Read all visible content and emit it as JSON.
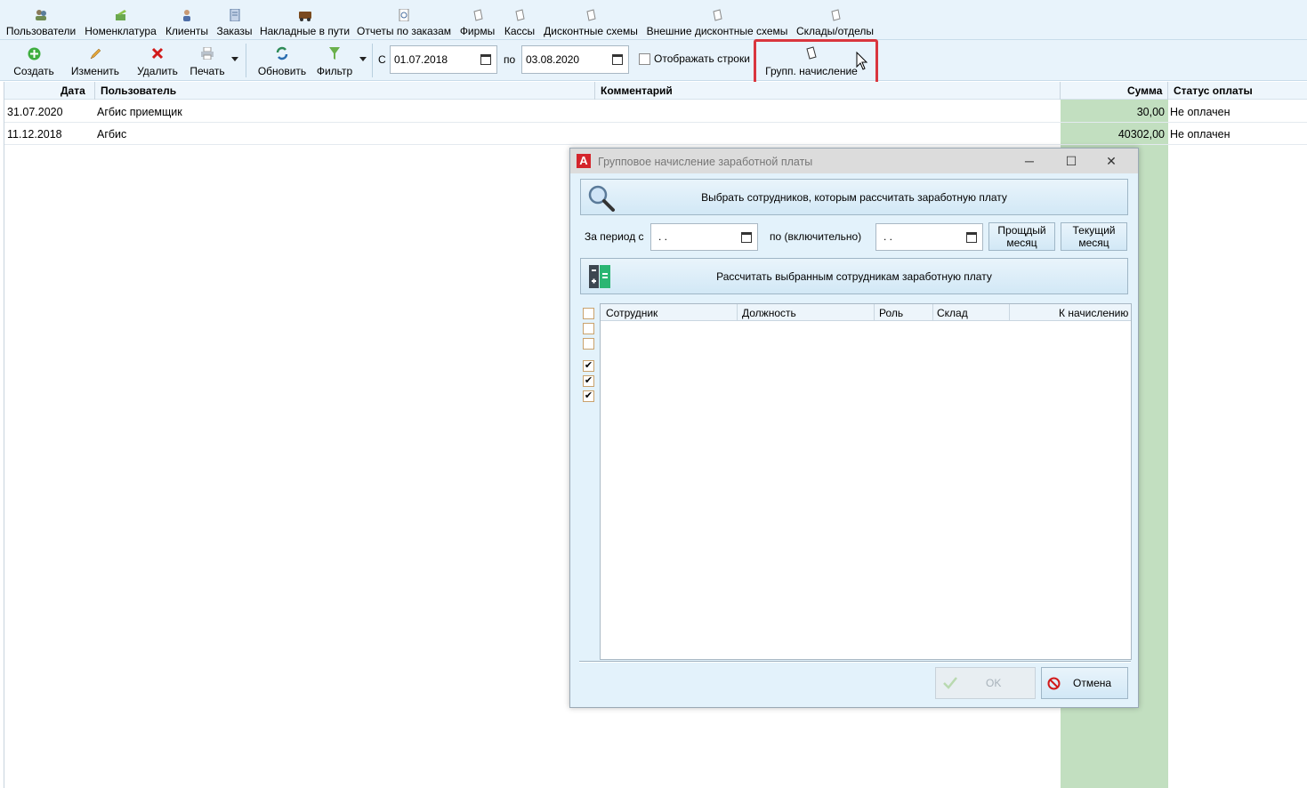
{
  "menu": {
    "items": [
      {
        "label": "Пользователи",
        "icon": "users-icon"
      },
      {
        "label": "Номенклатура",
        "icon": "nomenclature-icon"
      },
      {
        "label": "Клиенты",
        "icon": "clients-icon"
      },
      {
        "label": "Заказы",
        "icon": "orders-icon"
      },
      {
        "label": "Накладные в пути",
        "icon": "truck-icon"
      },
      {
        "label": "Отчеты по заказам",
        "icon": "report-icon"
      },
      {
        "label": "Фирмы",
        "icon": "document-icon"
      },
      {
        "label": "Кассы",
        "icon": "document-icon"
      },
      {
        "label": "Дисконтные схемы",
        "icon": "document-icon"
      },
      {
        "label": "Внешние дисконтные схемы",
        "icon": "document-icon"
      },
      {
        "label": "Склады/отделы",
        "icon": "document-icon"
      }
    ]
  },
  "toolbar": {
    "create": "Создать",
    "edit": "Изменить",
    "delete": "Удалить",
    "print": "Печать",
    "refresh": "Обновить",
    "filter": "Фильтр",
    "from_label": "С",
    "from_date": "01.07.2018",
    "to_label": "по",
    "to_date": "03.08.2020",
    "show_rows": "Отображать строки",
    "group_accrual": "Групп. начисление"
  },
  "grid": {
    "columns": [
      "Дата",
      "Пользователь",
      "Комментарий",
      "Сумма",
      "Статус оплаты"
    ],
    "rows": [
      {
        "date": "31.07.2020",
        "user": "Агбис приемщик",
        "comment": "",
        "sum": "30,00",
        "status": "Не оплачен"
      },
      {
        "date": "11.12.2018",
        "user": "Агбис",
        "comment": "",
        "sum": "40302,00",
        "status": "Не оплачен"
      }
    ]
  },
  "dialog": {
    "title": "Групповое начисление заработной платы",
    "select_button": "Выбрать сотрудников, которым рассчитать заработную плату",
    "period_from_label": "За период с",
    "period_from_value": ". .",
    "period_to_label": "по (включительно)",
    "period_to_value": ". .",
    "prev_month_line1": "Прощдый",
    "prev_month_line2": "месяц",
    "cur_month_line1": "Текущий",
    "cur_month_line2": "месяц",
    "calc_button": "Рассчитать выбранным сотрудникам заработную плату",
    "columns": [
      "Сотрудник",
      "Должность",
      "Роль",
      "Склад",
      "К начислению"
    ],
    "checkboxes": [
      false,
      false,
      false,
      true,
      true,
      true
    ],
    "ok": "OK",
    "cancel": "Отмена"
  }
}
